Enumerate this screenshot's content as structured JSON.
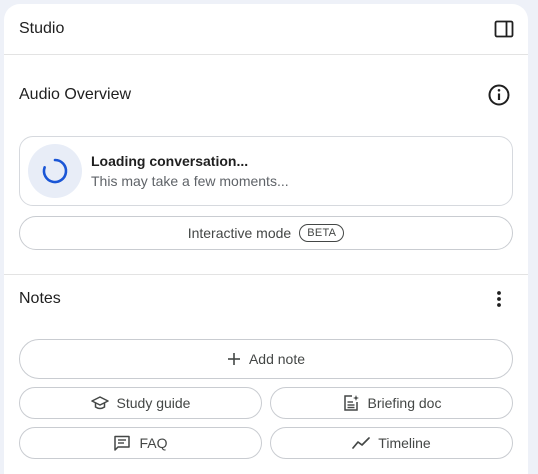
{
  "header": {
    "title": "Studio",
    "toggle_icon": "panel-toggle-icon"
  },
  "audio_overview": {
    "label": "Audio Overview",
    "info_icon": "info-icon",
    "loading_title": "Loading conversation...",
    "loading_subtitle": "This may take a few moments...",
    "interactive_label": "Interactive mode",
    "beta_badge": "BETA",
    "accent_color": "#1a56d6"
  },
  "notes": {
    "label": "Notes",
    "menu_icon": "more-vertical-icon",
    "add_note_label": "Add note",
    "buttons": [
      {
        "label": "Study guide",
        "icon": "graduation-cap-icon"
      },
      {
        "label": "Briefing doc",
        "icon": "document-sparkle-icon"
      },
      {
        "label": "FAQ",
        "icon": "chat-lines-icon"
      },
      {
        "label": "Timeline",
        "icon": "trend-line-icon"
      }
    ]
  }
}
